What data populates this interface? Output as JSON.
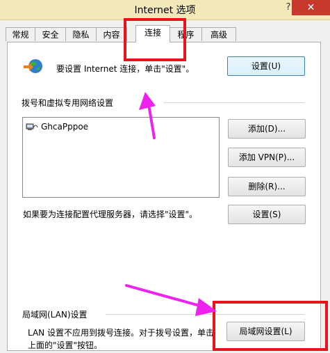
{
  "window": {
    "title": "Internet 选项",
    "help_label": "?",
    "close_label": "✕"
  },
  "tabs": [
    {
      "label": "常规"
    },
    {
      "label": "安全"
    },
    {
      "label": "隐私"
    },
    {
      "label": "内容"
    },
    {
      "label": "连接",
      "active": true
    },
    {
      "label": "程序"
    },
    {
      "label": "高级"
    }
  ],
  "setup": {
    "text": "要设置 Internet 连接，单击\"设置\"。",
    "button": "设置(U)"
  },
  "dialup": {
    "heading": "拨号和虚拟专用网络设置",
    "connections": [
      {
        "name": "GhcaPppoe"
      }
    ],
    "add_button": "添加(D)...",
    "add_vpn_button": "添加 VPN(P)...",
    "remove_button": "删除(R)...",
    "proxy_text": "如果要为连接配置代理服务器，请选择\"设置\"。",
    "settings_button": "设置(S)"
  },
  "lan": {
    "heading": "局域网(LAN)设置",
    "text_line1": "LAN 设置不应用到拨号连接。对于拨号设置，单击",
    "text_line2": "上面的\"设置\"按钮。",
    "button": "局域网设置(L)"
  },
  "annotation_colors": {
    "highlight_box": "#e8141c",
    "arrow": "#ee22ee"
  }
}
